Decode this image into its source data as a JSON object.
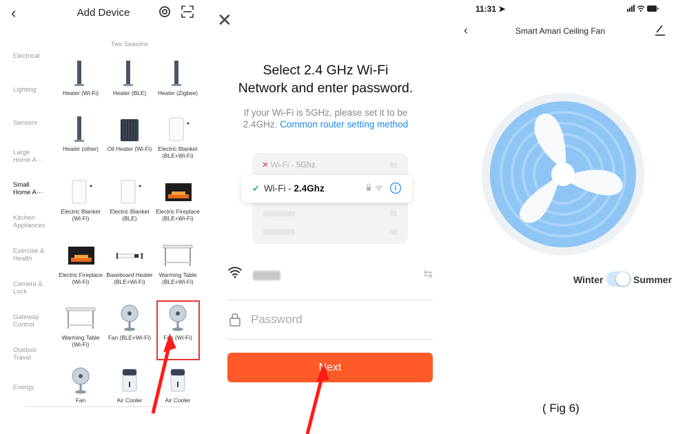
{
  "panel1": {
    "title": "Add Device",
    "subheader": "Two Seasons",
    "sidebar": [
      {
        "label": "Electrical",
        "active": false
      },
      {
        "label": "Lighting",
        "active": false
      },
      {
        "label": "Sensors",
        "active": false
      },
      {
        "label": "Large Home A···",
        "active": false
      },
      {
        "label": "Small Home A···",
        "active": true
      },
      {
        "label": "Kitchen Appliances",
        "active": false
      },
      {
        "label": "Exercise & Health",
        "active": false
      },
      {
        "label": "Camera & Lock",
        "active": false
      },
      {
        "label": "Gateway Control",
        "active": false
      },
      {
        "label": "Outdoor Travel",
        "active": false
      },
      {
        "label": "Energy",
        "active": false
      }
    ],
    "devices": [
      {
        "name": "Heater (Wi-Fi)",
        "icon": "heater-icon"
      },
      {
        "name": "Heater (BLE)",
        "icon": "heater-icon"
      },
      {
        "name": "Heater (Zigbee)",
        "icon": "heater-icon"
      },
      {
        "name": "Heater (other)",
        "icon": "heater-icon"
      },
      {
        "name": "Oil Heater (Wi-Fi)",
        "icon": "oil-heater-icon"
      },
      {
        "name": "Electric Blanket (BLE+Wi-Fi)",
        "icon": "electric-blanket-icon"
      },
      {
        "name": "Electric Blanket (Wi-Fi)",
        "icon": "electric-blanket-icon"
      },
      {
        "name": "Electric Blanket (BLE)",
        "icon": "electric-blanket-icon"
      },
      {
        "name": "Electric Fireplace (BLE+Wi-Fi)",
        "icon": "fireplace-icon"
      },
      {
        "name": "Electric Fireplace (Wi-Fi)",
        "icon": "fireplace-icon"
      },
      {
        "name": "Baseboard Heater (BLE+Wi-Fi)",
        "icon": "baseboard-heater-icon"
      },
      {
        "name": "Warming Table (BLE+Wi-Fi)",
        "icon": "warming-table-icon"
      },
      {
        "name": "Warming Table (Wi-Fi)",
        "icon": "warming-table-icon"
      },
      {
        "name": "Fan (BLE+Wi-Fi)",
        "icon": "fan-icon"
      },
      {
        "name": "Fan (Wi-Fi)",
        "icon": "fan-icon"
      },
      {
        "name": "Fan",
        "icon": "fan-icon"
      },
      {
        "name": "Air Cooler",
        "icon": "air-cooler-icon"
      },
      {
        "name": "Air Cooler",
        "icon": "air-cooler-icon"
      }
    ]
  },
  "panel2": {
    "heading_line1": "Select 2.4 GHz Wi-Fi",
    "heading_line2": "Network and enter password.",
    "note_line1": "If your Wi-Fi is 5GHz, please set it to be",
    "note_prefix": "2.4GHz.",
    "note_link": "Common router setting method",
    "wifi_5g_prefix": "Wi-Fi - ",
    "wifi_5g_band": "5Ghz",
    "wifi_24_prefix": "Wi-Fi - ",
    "wifi_24_band": "2.4Ghz",
    "password_placeholder": "Password",
    "next_label": "Next"
  },
  "panel3": {
    "time": "11:31",
    "title": "Smart Amari Ceiling Fan",
    "season_left": "Winter",
    "season_right": "Summer",
    "season_selected": "Summer",
    "caption": "( Fig 6)"
  },
  "colors": {
    "accent_orange": "#ff5a28",
    "link_blue": "#2188e8",
    "check_green": "#2bb38a",
    "highlight_red": "#e53935",
    "fan_blue": "#8ec5f5"
  }
}
